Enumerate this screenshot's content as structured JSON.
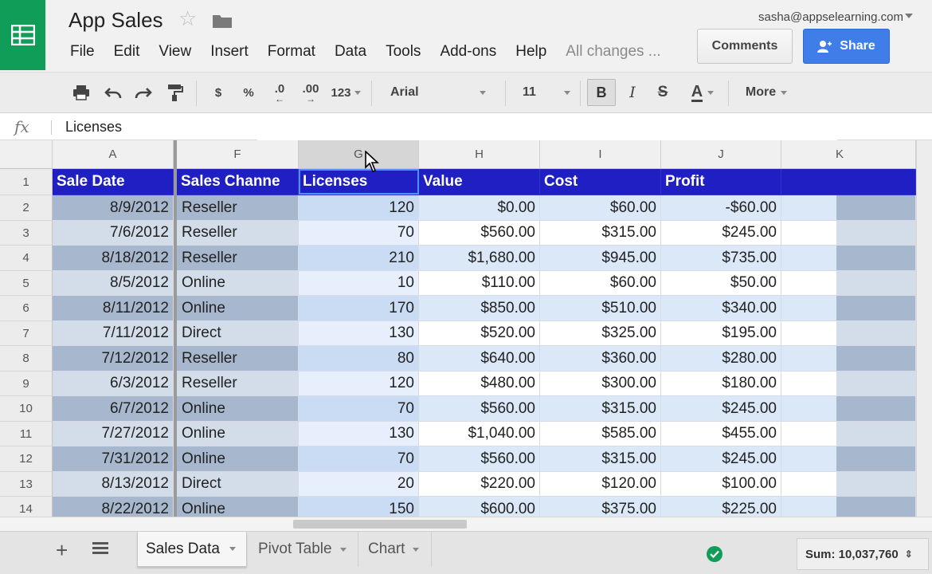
{
  "app": {
    "title": "App Sales",
    "user_email": "sasha@appselearning.com",
    "comments_label": "Comments",
    "share_label": "Share",
    "saved_status": "All changes ..."
  },
  "menu": [
    "File",
    "Edit",
    "View",
    "Insert",
    "Format",
    "Data",
    "Tools",
    "Add-ons",
    "Help"
  ],
  "toolbar": {
    "currency": "$",
    "percent": "%",
    "decrease_decimals": ".0",
    "increase_decimals": ".00",
    "number_format": "123",
    "font": "Arial",
    "font_size": "11",
    "bold": "B",
    "italic": "I",
    "strikethrough": "S",
    "text_color": "A",
    "more": "More"
  },
  "formula_bar": {
    "fx": "fx",
    "value": "Licenses"
  },
  "grid": {
    "columns": [
      "A",
      "F",
      "G",
      "H",
      "I",
      "J",
      "K"
    ],
    "header_row": {
      "row_num": "1",
      "cells": [
        "Sale Date",
        "Sales Channe",
        "Licenses",
        "Value",
        "Cost",
        "Profit"
      ]
    },
    "rows": [
      {
        "num": "2",
        "date": "8/9/2012",
        "channel": "Reseller",
        "licenses": "120",
        "value": "$0.00",
        "cost": "$60.00",
        "profit": "-$60.00"
      },
      {
        "num": "3",
        "date": "7/6/2012",
        "channel": "Reseller",
        "licenses": "70",
        "value": "$560.00",
        "cost": "$315.00",
        "profit": "$245.00"
      },
      {
        "num": "4",
        "date": "8/18/2012",
        "channel": "Reseller",
        "licenses": "210",
        "value": "$1,680.00",
        "cost": "$945.00",
        "profit": "$735.00"
      },
      {
        "num": "5",
        "date": "8/5/2012",
        "channel": "Online",
        "licenses": "10",
        "value": "$110.00",
        "cost": "$60.00",
        "profit": "$50.00"
      },
      {
        "num": "6",
        "date": "8/11/2012",
        "channel": "Online",
        "licenses": "170",
        "value": "$850.00",
        "cost": "$510.00",
        "profit": "$340.00"
      },
      {
        "num": "7",
        "date": "7/11/2012",
        "channel": "Direct",
        "licenses": "130",
        "value": "$520.00",
        "cost": "$325.00",
        "profit": "$195.00"
      },
      {
        "num": "8",
        "date": "7/12/2012",
        "channel": "Reseller",
        "licenses": "80",
        "value": "$640.00",
        "cost": "$360.00",
        "profit": "$280.00"
      },
      {
        "num": "9",
        "date": "6/3/2012",
        "channel": "Reseller",
        "licenses": "120",
        "value": "$480.00",
        "cost": "$300.00",
        "profit": "$180.00"
      },
      {
        "num": "10",
        "date": "6/7/2012",
        "channel": "Online",
        "licenses": "70",
        "value": "$560.00",
        "cost": "$315.00",
        "profit": "$245.00"
      },
      {
        "num": "11",
        "date": "7/27/2012",
        "channel": "Online",
        "licenses": "130",
        "value": "$1,040.00",
        "cost": "$585.00",
        "profit": "$455.00"
      },
      {
        "num": "12",
        "date": "7/31/2012",
        "channel": "Online",
        "licenses": "70",
        "value": "$560.00",
        "cost": "$315.00",
        "profit": "$245.00"
      },
      {
        "num": "13",
        "date": "8/13/2012",
        "channel": "Direct",
        "licenses": "20",
        "value": "$220.00",
        "cost": "$120.00",
        "profit": "$100.00"
      },
      {
        "num": "14",
        "date": "8/22/2012",
        "channel": "Online",
        "licenses": "150",
        "value": "$600.00",
        "cost": "$375.00",
        "profit": "$225.00"
      }
    ]
  },
  "sheets": [
    "Sales Data",
    "Pivot Table",
    "Chart"
  ],
  "status": {
    "sum": "Sum: 10,037,760"
  },
  "colors": {
    "header_fill": "#1f1fc4",
    "band_dark": "#a7b7cd",
    "band_light": "#d3ddea",
    "panel_band": "#dbe8f8",
    "logo_green": "#0f9d58",
    "share_blue": "#3f7ee8"
  }
}
